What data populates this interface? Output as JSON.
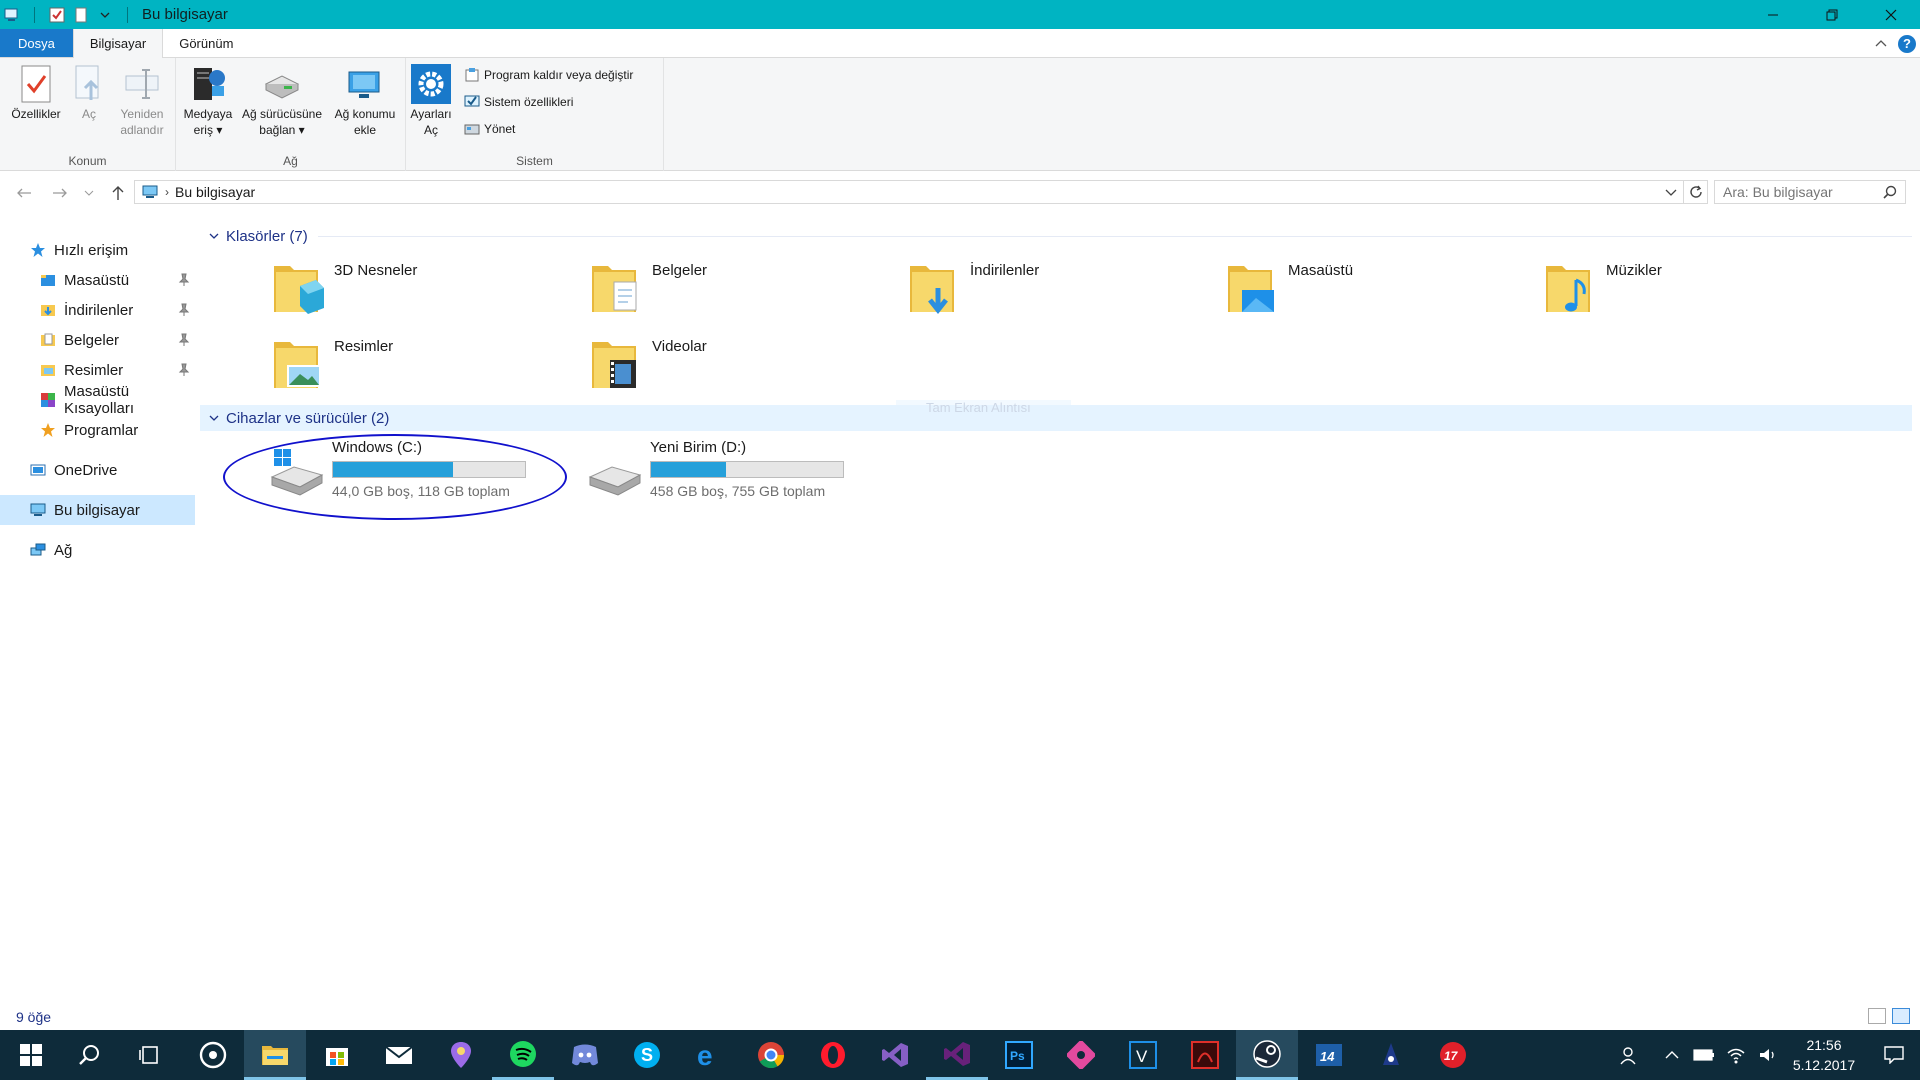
{
  "window": {
    "title": "Bu bilgisayar"
  },
  "ribbon_tabs": {
    "file": "Dosya",
    "computer": "Bilgisayar",
    "view": "Görünüm"
  },
  "ribbon": {
    "konum": {
      "label": "Konum",
      "properties": "Özellikler",
      "open": "Aç",
      "rename_1": "Yeniden",
      "rename_2": "adlandır"
    },
    "ag": {
      "label": "Ağ",
      "media_1": "Medyaya",
      "media_2": "eriş",
      "map_1": "Ağ sürücüsüne",
      "map_2": "bağlan",
      "addloc_1": "Ağ konumu",
      "addloc_2": "ekle"
    },
    "sistem": {
      "label": "Sistem",
      "settings_1": "Ayarları",
      "settings_2": "Aç",
      "uninstall": "Program kaldır veya değiştir",
      "sysprops": "Sistem özellikleri",
      "manage": "Yönet"
    }
  },
  "address": {
    "path": "Bu bilgisayar",
    "search_placeholder": "Ara: Bu bilgisayar"
  },
  "nav": {
    "quick_access": "Hızlı erişim",
    "desktop": "Masaüstü",
    "downloads": "İndirilenler",
    "documents": "Belgeler",
    "pictures": "Resimler",
    "desktop_shortcuts": "Masaüstü Kısayolları",
    "programs": "Programlar",
    "onedrive": "OneDrive",
    "this_pc": "Bu bilgisayar",
    "network": "Ağ"
  },
  "folders_section": "Klasörler (7)",
  "folders": [
    "3D Nesneler",
    "Belgeler",
    "İndirilenler",
    "Masaüstü",
    "Müzikler",
    "Resimler",
    "Videolar"
  ],
  "drives_section": "Cihazlar ve sürücüler (2)",
  "ghost_text": "Tam Ekran Alıntısı",
  "drives": [
    {
      "name": "Windows (C:)",
      "info": "44,0 GB boş, 118 GB toplam",
      "used_fraction": 0.627
    },
    {
      "name": "Yeni Birim (D:)",
      "info": "458 GB boş, 755 GB toplam",
      "used_fraction": 0.393
    }
  ],
  "status": {
    "count": "9 öğe"
  },
  "taskbar": {
    "time": "21:56",
    "date": "5.12.2017"
  },
  "colors": {
    "titlebar": "#00b4c2",
    "accent": "#1979ca",
    "taskbar": "#0e2b3a",
    "drive_bar": "#26a0da"
  }
}
